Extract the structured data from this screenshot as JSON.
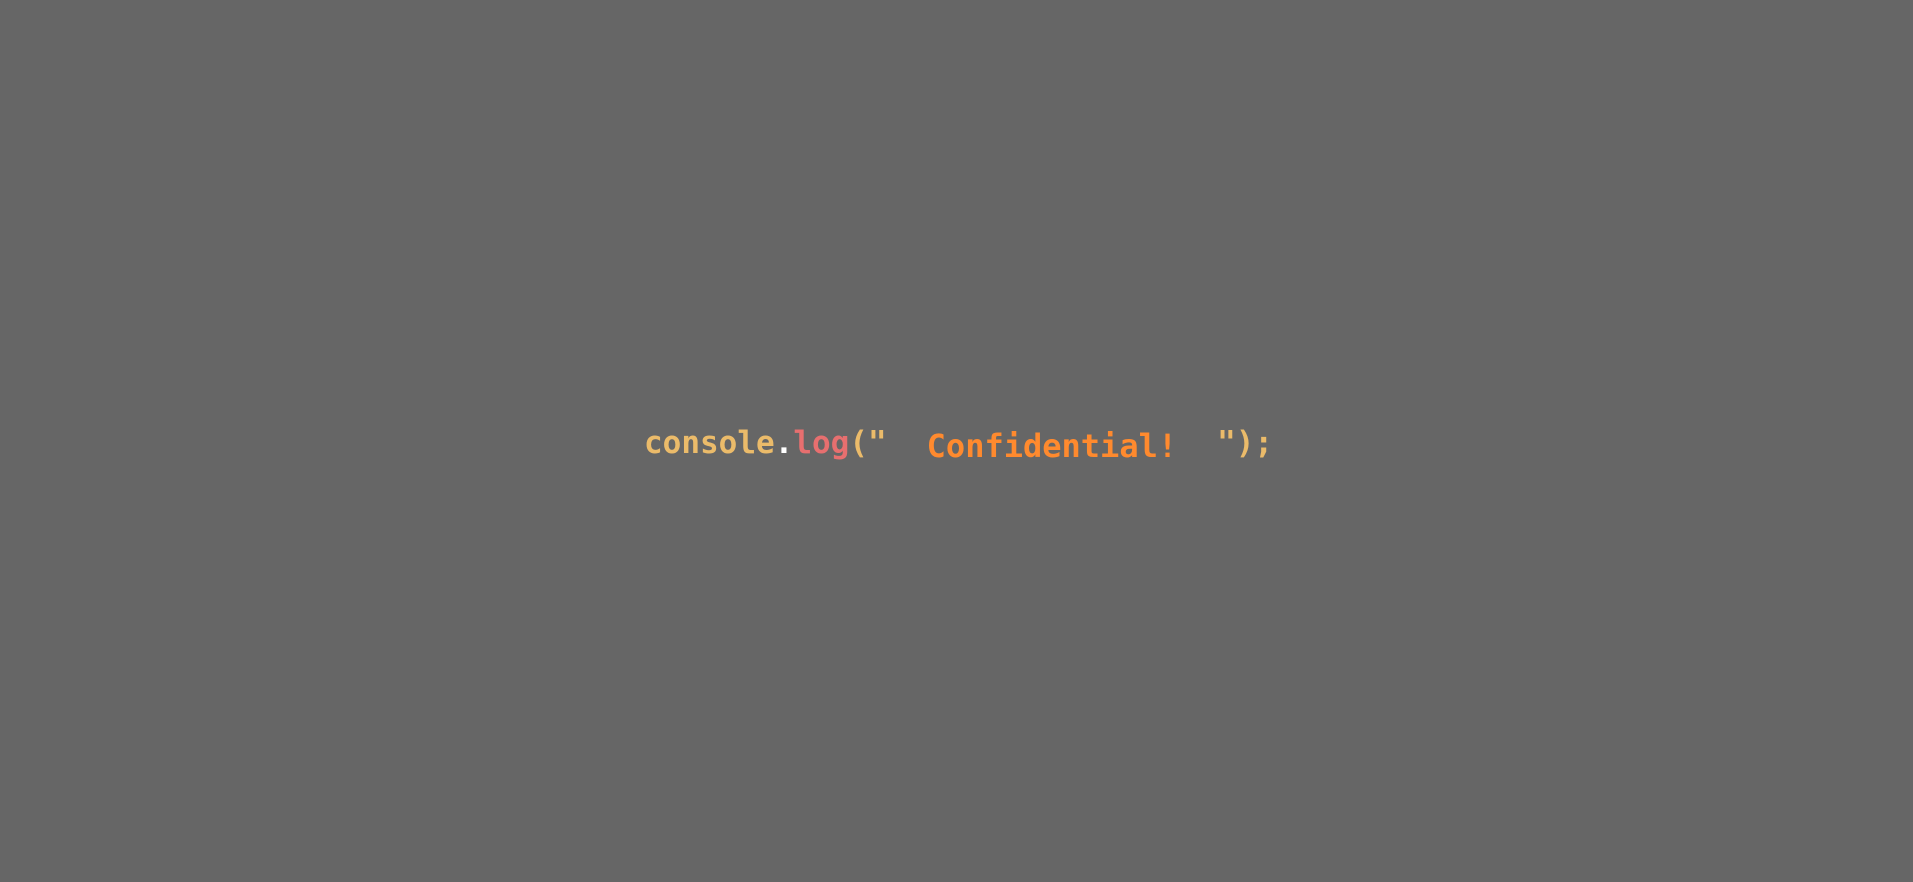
{
  "code": {
    "object": "console",
    "dot": ".",
    "method": "log",
    "open": "(\"",
    "string": "Confidential!",
    "close": "\");"
  },
  "colors": {
    "background": "#666666",
    "object": "#ebbb6a",
    "dot": "#ffffff",
    "method": "#e76f6f",
    "string": "#ff8a2e"
  }
}
